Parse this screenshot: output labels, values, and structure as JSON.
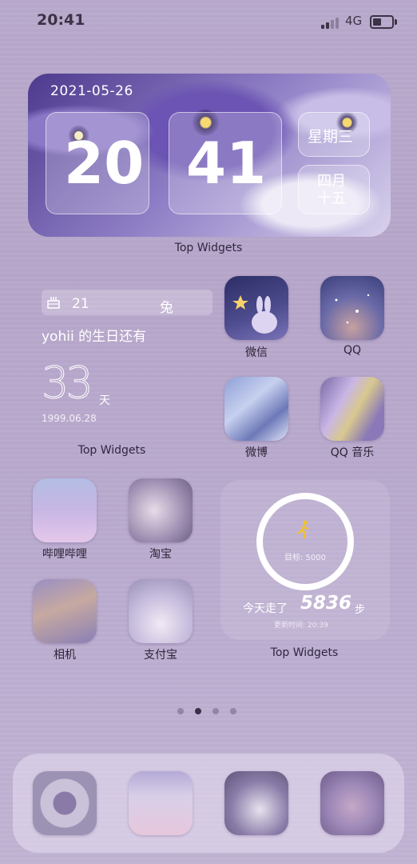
{
  "status_bar": {
    "time": "20:41",
    "network": "4G"
  },
  "clock_widget": {
    "date": "2021-05-26",
    "hour": "20",
    "minute": "41",
    "weekday": "星期三",
    "lunar_month": "四月",
    "lunar_day": "十五",
    "label": "Top Widgets"
  },
  "birthday_widget": {
    "count": "21",
    "zodiac": "兔",
    "text": "yohii 的生日还有",
    "days": "33",
    "unit": "天",
    "birth_date": "1999.06.28",
    "label": "Top Widgets"
  },
  "apps": [
    {
      "name": "wechat",
      "label": "微信"
    },
    {
      "name": "qq",
      "label": "QQ"
    },
    {
      "name": "weibo",
      "label": "微博"
    },
    {
      "name": "qq-music",
      "label": "QQ 音乐"
    },
    {
      "name": "bilibili",
      "label": "哔哩哔哩"
    },
    {
      "name": "taobao",
      "label": "淘宝"
    },
    {
      "name": "camera",
      "label": "相机"
    },
    {
      "name": "alipay",
      "label": "支付宝"
    }
  ],
  "steps_widget": {
    "goal": "目标: 5000",
    "prefix": "今天走了",
    "steps": "5836",
    "unit": "步",
    "updated": "更新时间: 20:39",
    "label": "Top Widgets"
  },
  "page_indicator": {
    "pages": 4,
    "current": 2
  },
  "dock": [
    "dock-app-1",
    "dock-app-2",
    "dock-app-3",
    "dock-app-4"
  ],
  "colors": {
    "text_dark": "#2c2437",
    "accent_yellow": "#f2c12e"
  }
}
